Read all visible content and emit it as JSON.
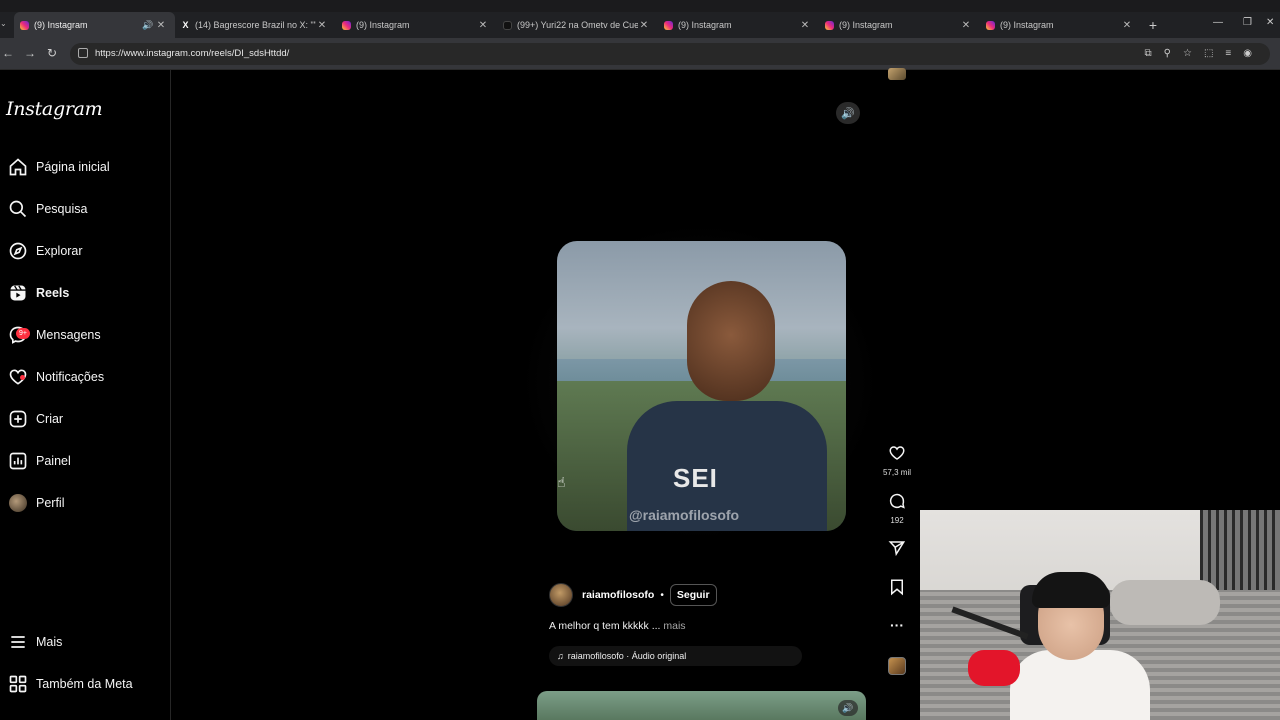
{
  "browser": {
    "tabs": [
      {
        "title": "(9) Instagram",
        "favicon": "instagram-icon",
        "active": true,
        "audio": true
      },
      {
        "title": "(14) Bagrescore Brazil no X: \"\"A",
        "favicon": "x-icon",
        "active": false
      },
      {
        "title": "(9) Instagram",
        "favicon": "instagram-icon",
        "active": false
      },
      {
        "title": "(99+) Yuri22 na Ometv de Cue",
        "favicon": "tiktok-icon",
        "active": false
      },
      {
        "title": "(9) Instagram",
        "favicon": "instagram-icon",
        "active": false
      },
      {
        "title": "(9) Instagram",
        "favicon": "instagram-icon",
        "active": false
      },
      {
        "title": "(9) Instagram",
        "favicon": "instagram-icon",
        "active": false
      }
    ],
    "url": "https://www.instagram.com/reels/DI_sdsHttdd/"
  },
  "sidebar": {
    "logo": "Instagram",
    "items": [
      {
        "label": "Página inicial",
        "icon": "home-icon"
      },
      {
        "label": "Pesquisa",
        "icon": "search-icon"
      },
      {
        "label": "Explorar",
        "icon": "compass-icon"
      },
      {
        "label": "Reels",
        "icon": "reels-icon",
        "active": true
      },
      {
        "label": "Mensagens",
        "icon": "messenger-icon",
        "badge": "9+"
      },
      {
        "label": "Notificações",
        "icon": "heart-icon",
        "dot": true
      },
      {
        "label": "Criar",
        "icon": "plus-square-icon"
      },
      {
        "label": "Painel",
        "icon": "dashboard-icon"
      },
      {
        "label": "Perfil",
        "icon": "avatar"
      }
    ],
    "bottom": [
      {
        "label": "Mais",
        "icon": "menu-icon"
      },
      {
        "label": "Também da Meta",
        "icon": "meta-grid-icon"
      }
    ]
  },
  "reel": {
    "overlay_text": "SEI",
    "watermark": "@raiamofilosofo",
    "likes": "57,3 mil",
    "comments": "192",
    "author": "raiamofilosofo",
    "separator": "•",
    "follow_label": "Seguir",
    "caption": "A melhor q tem kkkkk ...",
    "caption_more": "mais",
    "audio_label": "raiamofilosofo · Áudio original"
  },
  "colors": {
    "badge": "#ff3040",
    "background": "#000000",
    "chrome": "#202124"
  }
}
